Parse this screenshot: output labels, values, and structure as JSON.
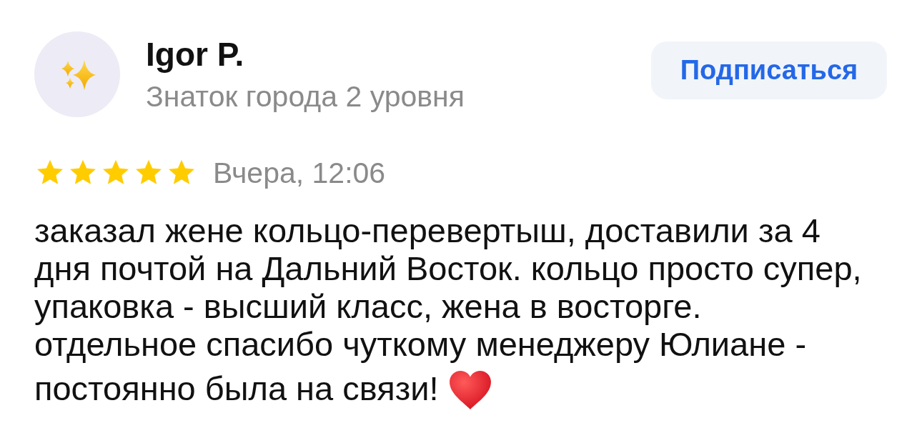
{
  "author": {
    "name": "Igor P.",
    "status": "Знаток города 2 уровня"
  },
  "subscribe_button": {
    "label": "Подписаться"
  },
  "review": {
    "stars": 5,
    "date": "Вчера, 12:06",
    "text_lines": [
      "заказал жене кольцо-перевертыш, доставили за 4",
      "дня почтой на Дальний Восток. кольцо просто супер,",
      "упаковка - высший класс, жена в восторге.",
      "отдельное спасибо чуткому менеджеру Юлиане -",
      "постоянно была на связи!"
    ]
  }
}
